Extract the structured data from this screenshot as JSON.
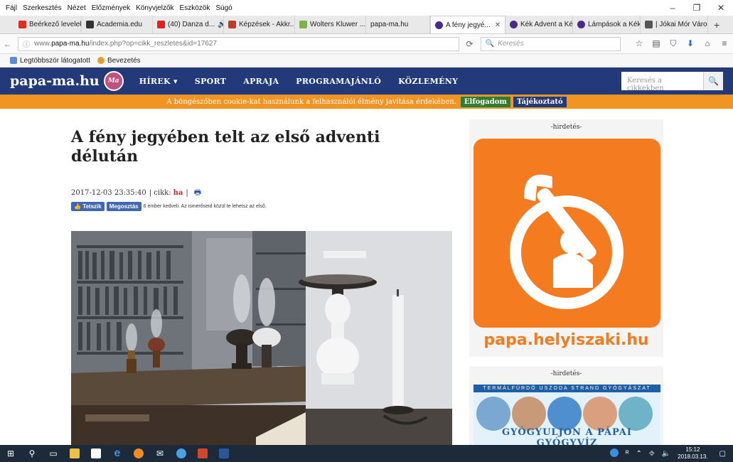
{
  "menubar": [
    "Fájl",
    "Szerkesztés",
    "Nézet",
    "Előzmények",
    "Könyvjelzők",
    "Eszközök",
    "Súgó"
  ],
  "tabs": [
    {
      "label": "Beérkező levelek...",
      "color": "#d93025"
    },
    {
      "label": "Academia.edu",
      "color": "#333333"
    },
    {
      "label": "(40) Danza d...",
      "color": "#e62117"
    },
    {
      "label": "Képzések - Akkr...",
      "color": "#c0392b"
    },
    {
      "label": "Wolters Kluwer ...",
      "color": "#7cb342"
    },
    {
      "label": "papa-ma.hu",
      "color": "#cccccc"
    },
    {
      "label": "A fény jegyé...",
      "color": "#4a2a8a",
      "active": true
    },
    {
      "label": "Kék Advent a Ké...",
      "color": "#4a2a8a"
    },
    {
      "label": "Lámpások a Kék...",
      "color": "#4a2a8a"
    },
    {
      "label": "| Jókai Mór Váro...",
      "color": "#555555"
    }
  ],
  "url": {
    "prefix": "www.",
    "domain": "papa-ma.hu",
    "path": "/index.php?op=cikk_reszletes&id=17627"
  },
  "search_placeholder": "Keresés",
  "bookmarks": [
    "Legtöbbször látogatott",
    "Bevezetés"
  ],
  "site": {
    "logo": "papa-ma.hu",
    "logo_badge": "Ma",
    "menu": [
      "HÍREK ▾",
      "SPORT",
      "APRAJA",
      "PROGRAMAJÁNLÓ",
      "KÖZLEMÉNY"
    ],
    "search_placeholder": "Keresés a cikkekben"
  },
  "cookie": {
    "text": "A böngészőben cookie-kat használunk a felhasználói élmény javítása érdekében.",
    "accept": "Elfogadom",
    "info": "Tájékoztató"
  },
  "article": {
    "title": "A fény jegyében telt az első adventi délután",
    "date": "2017-12-03 23:35:40",
    "cikk_label": "| cikk:",
    "author": "ha",
    "sep": "|",
    "like": "Tetszik",
    "share": "Megosztás",
    "likes_text": "6 ember kedveli. Az ismerőseid közül te lehetsz az első."
  },
  "sidebar": {
    "ad_label": "-hirdetés-",
    "ad1_text": "papa.helyiszaki.hu",
    "ad2_top": "TERMÁLFÜRDŐ  USZODA  STRAND  GYÓGYÁSZAT",
    "ad2_bottom": "GYÓGYULJON A PÁPAI GYÓGYVÍZ"
  },
  "taskbar": {
    "time": "15:12",
    "date": "2018.03.13."
  }
}
